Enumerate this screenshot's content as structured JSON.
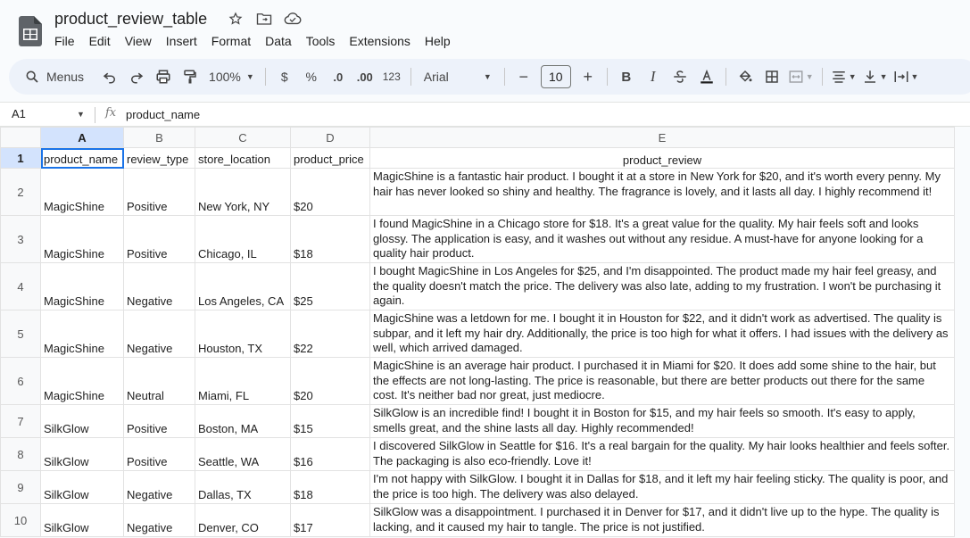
{
  "app": {
    "title": "product_review_table",
    "menus": [
      "File",
      "Edit",
      "View",
      "Insert",
      "Format",
      "Data",
      "Tools",
      "Extensions",
      "Help"
    ]
  },
  "toolbar": {
    "menus_label": "Menus",
    "zoom": "100%",
    "currency": "$",
    "percent": "%",
    "decrease_decimal": ".0",
    "increase_decimal": ".00",
    "number_format": "123",
    "font": "Arial",
    "font_size": "10",
    "bold": "B",
    "italic": "I"
  },
  "formula_bar": {
    "cell_ref": "A1",
    "fx": "fx",
    "content": "product_name"
  },
  "grid": {
    "columns": [
      "A",
      "B",
      "C",
      "D",
      "E"
    ],
    "row_numbers": [
      "1",
      "2",
      "3",
      "4",
      "5",
      "6",
      "7",
      "8",
      "9",
      "10"
    ],
    "header": [
      "product_name",
      "review_type",
      "store_location",
      "product_price",
      "product_review"
    ],
    "rows": [
      [
        "MagicShine",
        "Positive",
        "New York, NY",
        "$20",
        "MagicShine is a fantastic hair product. I bought it at a store in New York for $20, and it's worth every penny. My hair has never looked so shiny and healthy. The fragrance is lovely, and it lasts all day. I highly recommend it!"
      ],
      [
        "MagicShine",
        "Positive",
        "Chicago, IL",
        "$18",
        "I found MagicShine in a Chicago store for $18. It's a great value for the quality. My hair feels soft and looks glossy. The application is easy, and it washes out without any residue. A must-have for anyone looking for a quality hair product."
      ],
      [
        "MagicShine",
        "Negative",
        "Los Angeles, CA",
        "$25",
        "I bought MagicShine in Los Angeles for $25, and I'm disappointed. The product made my hair feel greasy, and the quality doesn't match the price. The delivery was also late, adding to my frustration. I won't be purchasing it again."
      ],
      [
        "MagicShine",
        "Negative",
        "Houston, TX",
        "$22",
        "MagicShine was a letdown for me. I bought it in Houston for $22, and it didn't work as advertised. The quality is subpar, and it left my hair dry. Additionally, the price is too high for what it offers. I had issues with the delivery as well, which arrived damaged."
      ],
      [
        "MagicShine",
        "Neutral",
        "Miami, FL",
        "$20",
        "MagicShine is an average hair product. I purchased it in Miami for $20. It does add some shine to the hair, but the effects are not long-lasting. The price is reasonable, but there are better products out there for the same cost. It's neither bad nor great, just mediocre."
      ],
      [
        "SilkGlow",
        "Positive",
        "Boston, MA",
        "$15",
        "SilkGlow is an incredible find! I bought it in Boston for $15, and my hair feels so smooth. It's easy to apply, smells great, and the shine lasts all day. Highly recommended!"
      ],
      [
        "SilkGlow",
        "Positive",
        "Seattle, WA",
        "$16",
        "I discovered SilkGlow in Seattle for $16. It's a real bargain for the quality. My hair looks healthier and feels softer. The packaging is also eco-friendly. Love it!"
      ],
      [
        "SilkGlow",
        "Negative",
        "Dallas, TX",
        "$18",
        "I'm not happy with SilkGlow. I bought it in Dallas for $18, and it left my hair feeling sticky. The quality is poor, and the price is too high. The delivery was also delayed."
      ],
      [
        "SilkGlow",
        "Negative",
        "Denver, CO",
        "$17",
        "SilkGlow was a disappointment. I purchased it in Denver for $17, and it didn't live up to the hype. The quality is lacking, and it caused my hair to tangle. The price is not justified."
      ]
    ]
  }
}
